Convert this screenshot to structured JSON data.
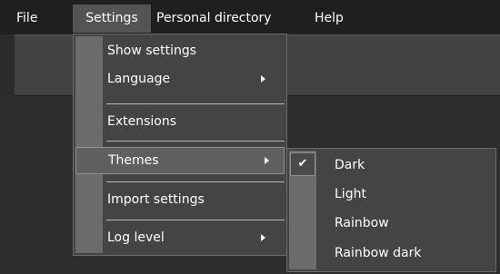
{
  "menubar": {
    "items": [
      {
        "label": "File"
      },
      {
        "label": "Settings"
      },
      {
        "label": "Personal directory"
      },
      {
        "label": "Help"
      }
    ]
  },
  "settings_menu": {
    "items": [
      {
        "label": "Show settings"
      },
      {
        "label": "Language",
        "has_submenu": true
      },
      {
        "label": "Extensions"
      },
      {
        "label": "Themes",
        "has_submenu": true,
        "highlighted": true
      },
      {
        "label": "Import settings"
      },
      {
        "label": "Log level",
        "has_submenu": true
      }
    ]
  },
  "themes_menu": {
    "checked_glyph": "✔",
    "items": [
      {
        "label": "Dark",
        "checked": true
      },
      {
        "label": "Light"
      },
      {
        "label": "Rainbow"
      },
      {
        "label": "Rainbow dark"
      }
    ]
  }
}
